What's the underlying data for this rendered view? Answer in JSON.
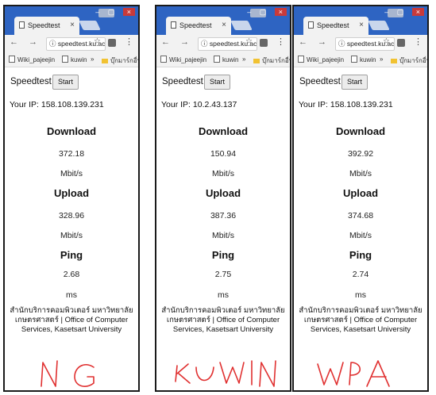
{
  "windows": [
    {
      "tab_title": "Speedtest",
      "tab_close": "×",
      "url": "speedtest.ku.ac.",
      "bookmarks": [
        "Wiki_pajeejin",
        "kuwin",
        "»",
        "บุ๊กมาร์กอื่นๆ"
      ],
      "app_title": "Speedtest",
      "start_label": "Start",
      "ip": "Your IP: 158.108.139.231",
      "download_label": "Download",
      "download_value": "372.18",
      "download_unit": "Mbit/s",
      "upload_label": "Upload",
      "upload_value": "328.96",
      "upload_unit": "Mbit/s",
      "ping_label": "Ping",
      "ping_value": "2.68",
      "ping_unit": "ms",
      "footer_line1": "สำนักบริการคอมพิวเตอร์ มหาวิทยาลัย",
      "footer_line2": "เกษตรศาสตร์ | Office of Computer",
      "footer_line3": "Services, Kasetsart University",
      "handwritten": "NG"
    },
    {
      "tab_title": "Speedtest",
      "tab_close": "×",
      "url": "speedtest.ku.ac.",
      "bookmarks": [
        "Wiki_pajeejin",
        "kuwin",
        "»",
        "บุ๊กมาร์กอื่นๆ"
      ],
      "app_title": "Speedtest",
      "start_label": "Start",
      "ip": "Your IP: 10.2.43.137",
      "download_label": "Download",
      "download_value": "150.94",
      "download_unit": "Mbit/s",
      "upload_label": "Upload",
      "upload_value": "387.36",
      "upload_unit": "Mbit/s",
      "ping_label": "Ping",
      "ping_value": "2.75",
      "ping_unit": "ms",
      "footer_line1": "สำนักบริการคอมพิวเตอร์ มหาวิทยาลัย",
      "footer_line2": "เกษตรศาสตร์ | Office of Computer",
      "footer_line3": "Services, Kasetsart University",
      "handwritten": "KUWIN"
    },
    {
      "tab_title": "Speedtest",
      "tab_close": "×",
      "url": "speedtest.ku.ac.",
      "bookmarks": [
        "Wiki_pajeejin",
        "kuwin",
        "»",
        "บุ๊กมาร์กอื่นๆ"
      ],
      "app_title": "Speedtest",
      "start_label": "Start",
      "ip": "Your IP: 158.108.139.231",
      "download_label": "Download",
      "download_value": "392.92",
      "download_unit": "Mbit/s",
      "upload_label": "Upload",
      "upload_value": "374.68",
      "upload_unit": "Mbit/s",
      "ping_label": "Ping",
      "ping_value": "2.74",
      "ping_unit": "ms",
      "footer_line1": "สำนักบริการคอมพิวเตอร์ มหาวิทยาลัย",
      "footer_line2": "เกษตรศาสตร์ | Office of Computer",
      "footer_line3": "Services, Kasetsart University",
      "handwritten": "WPA"
    }
  ],
  "colors": {
    "titlebar": "#2e64c2",
    "annotation": "#e03030"
  }
}
